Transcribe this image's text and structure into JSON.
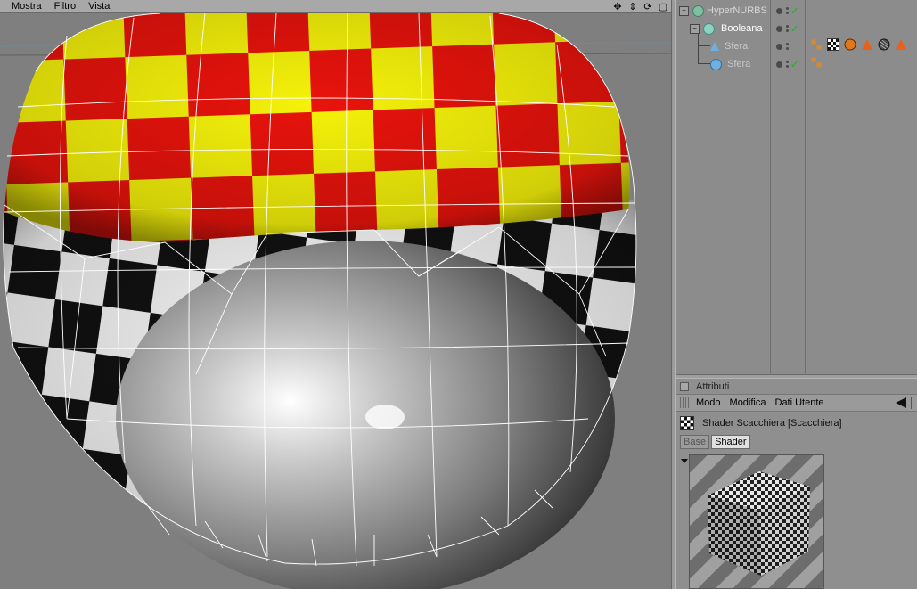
{
  "viewport": {
    "menu": [
      "Mostra",
      "Filtro",
      "Vista"
    ],
    "nav_icons": [
      "move-view-icon",
      "dolly-view-icon",
      "rotate-view-icon",
      "maximize-view-icon"
    ]
  },
  "object_manager": {
    "objects": [
      {
        "name": "HyperNURBS",
        "icon": "hypernurbs-icon",
        "depth": 0,
        "dimmed": true,
        "visible_check": true
      },
      {
        "name": "Booleana",
        "icon": "boolean-icon",
        "depth": 1,
        "dimmed": false,
        "visible_check": true
      },
      {
        "name": "Sfera",
        "icon": "sphere-icon",
        "depth": 2,
        "dimmed": true,
        "visible_check": false,
        "tags": [
          "texture-tag-icon",
          "checker-material-icon",
          "orange-material-icon",
          "phong-tag-icon",
          "dark-material-icon",
          "phong-tag-icon"
        ]
      },
      {
        "name": "Sfera",
        "icon": "sphere-icon",
        "depth": 2,
        "dimmed": true,
        "visible_check": true,
        "tags": [
          "texture-tag-icon"
        ]
      }
    ]
  },
  "attributes": {
    "header": "Attributi",
    "menu": [
      "Modo",
      "Modifica",
      "Dati Utente"
    ],
    "shader_title": "Shader Scacchiera [Scacchiera]",
    "tabs": [
      {
        "label": "Base",
        "active": false
      },
      {
        "label": "Shader",
        "active": true
      }
    ]
  },
  "colors": {
    "checker_red": "#e8130c",
    "checker_yellow": "#f5f20a",
    "checker_black": "#111111",
    "checker_white": "#f2f2f2",
    "viewport_bg": "#7f7f7f",
    "panel_bg": "#8c8c8c"
  }
}
